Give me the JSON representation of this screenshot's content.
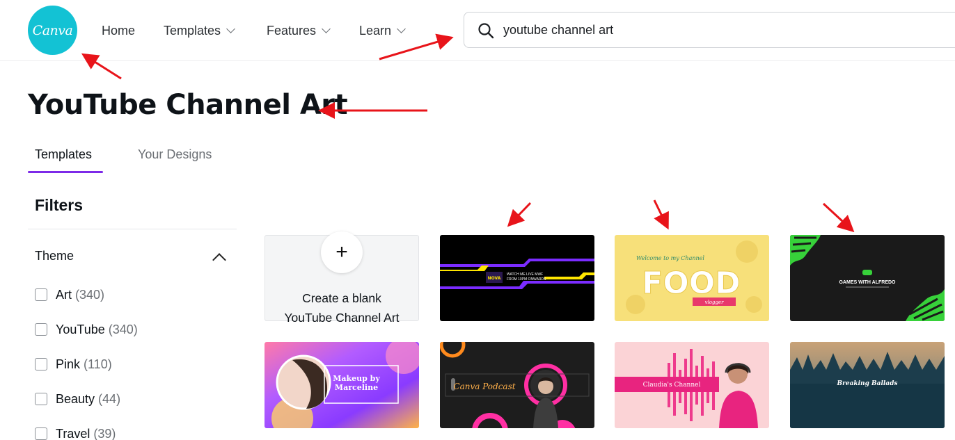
{
  "header": {
    "logo_text": "Canva",
    "nav": [
      {
        "label": "Home",
        "dropdown": false
      },
      {
        "label": "Templates",
        "dropdown": true
      },
      {
        "label": "Features",
        "dropdown": true
      },
      {
        "label": "Learn",
        "dropdown": true
      }
    ],
    "search": {
      "value": "youtube channel art",
      "icon": "search-icon"
    }
  },
  "page": {
    "title": "YouTube Channel Art"
  },
  "tabs": [
    {
      "label": "Templates",
      "active": true
    },
    {
      "label": "Your Designs",
      "active": false
    }
  ],
  "filters": {
    "title": "Filters",
    "theme": {
      "label": "Theme",
      "expanded": true,
      "options": [
        {
          "label": "Art",
          "count": "(340)",
          "checked": false
        },
        {
          "label": "YouTube",
          "count": "(340)",
          "checked": false
        },
        {
          "label": "Pink",
          "count": "(110)",
          "checked": false
        },
        {
          "label": "Beauty",
          "count": "(44)",
          "checked": false
        },
        {
          "label": "Travel",
          "count": "(39)",
          "checked": false
        }
      ]
    }
  },
  "templates": {
    "blank": {
      "plus": "+",
      "line1": "Create a blank",
      "line2": "YouTube Channel Art"
    },
    "cards": [
      {
        "name": "gaming-neon-banner",
        "line1": "WATCH ME LIVE MWF",
        "line2": "FROM 10PM ONWARDS"
      },
      {
        "name": "food-vlogger-banner",
        "welcome": "Welcome to my Channel",
        "title": "FOOD",
        "ribbon": "vlogger"
      },
      {
        "name": "games-with-alfredo-banner",
        "title": "GAMES WITH ALFREDO"
      },
      {
        "name": "makeup-by-marceline-banner",
        "title_line1": "Makeup by",
        "title_line2": "Marceline"
      },
      {
        "name": "canva-podcast-banner",
        "title": "Canva Podcast"
      },
      {
        "name": "claudias-channel-banner",
        "title": "Claudia's Channel"
      },
      {
        "name": "breaking-ballads-banner",
        "title": "Breaking Ballads"
      }
    ]
  },
  "colors": {
    "brand": "#13c2d4",
    "tab_accent": "#7d2ae8",
    "annotation_arrow": "#e8141a"
  }
}
